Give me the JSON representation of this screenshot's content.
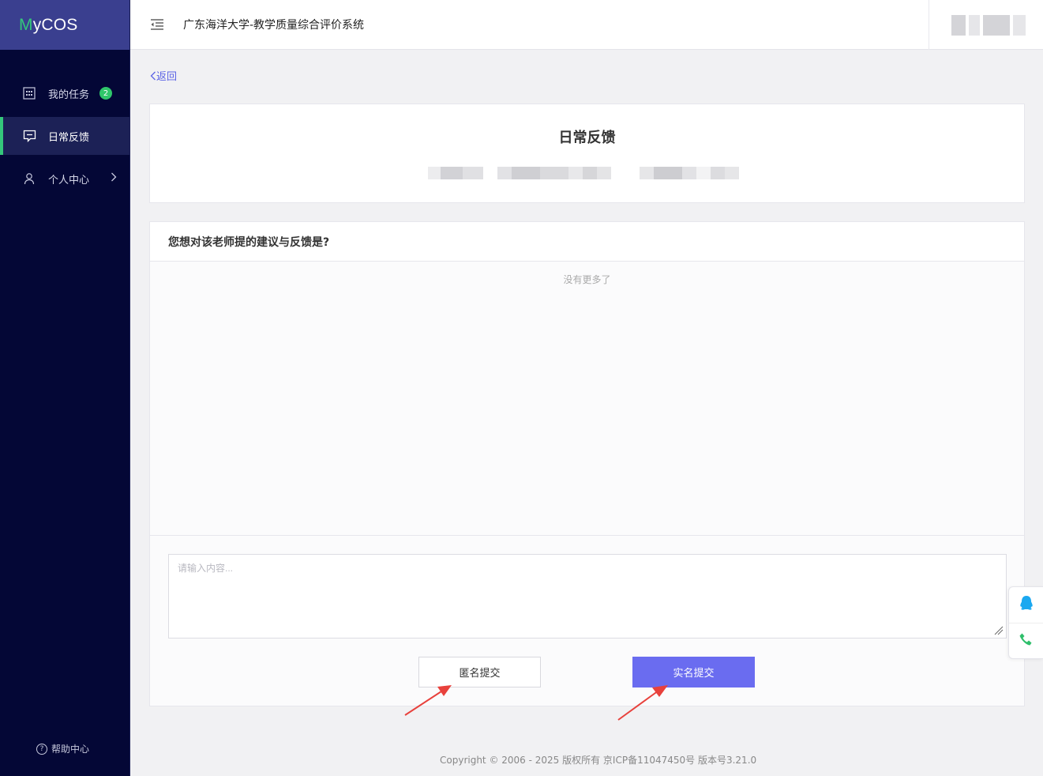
{
  "sidebar": {
    "logo_m": "M",
    "logo_rest": "yCOS",
    "items": [
      {
        "label": "我的任务",
        "badge": "2"
      },
      {
        "label": "日常反馈"
      },
      {
        "label": "个人中心"
      }
    ],
    "help": "帮助中心"
  },
  "header": {
    "title": "广东海洋大学-教学质量综合评价系统"
  },
  "main": {
    "back": "返回",
    "card_title": "日常反馈",
    "question": "您想对该老师提的建议与反馈是?",
    "empty_text": "没有更多了",
    "input_placeholder": "请输入内容...",
    "anon_button": "匿名提交",
    "real_button": "实名提交"
  },
  "footer": "Copyright © 2006 - 2025 版权所有 京ICP备11047450号 版本号3.21.0",
  "colors": {
    "sidebar_bg": "#040736",
    "accent_green": "#34c77b",
    "primary": "#6a6cf0",
    "arrow_red": "#e8413c"
  }
}
